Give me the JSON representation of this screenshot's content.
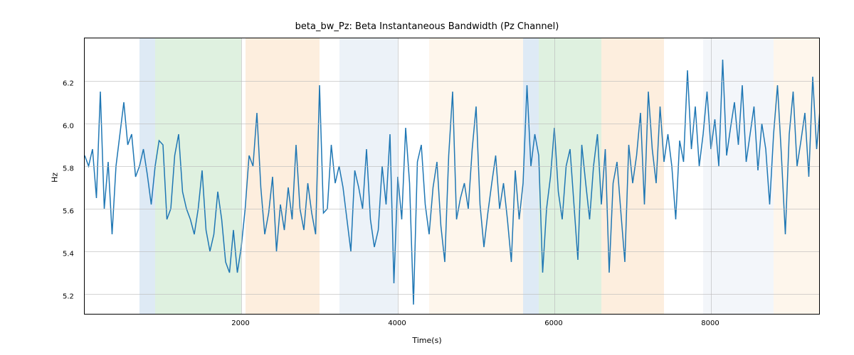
{
  "chart_data": {
    "type": "line",
    "title": "beta_bw_Pz: Beta Instantaneous Bandwidth (Pz Channel)",
    "xlabel": "Time(s)",
    "ylabel": "Hz",
    "xlim": [
      0,
      9400
    ],
    "ylim": [
      5.1,
      6.4
    ],
    "xticks": [
      2000,
      4000,
      6000,
      8000
    ],
    "yticks": [
      5.2,
      5.4,
      5.6,
      5.8,
      6.0,
      6.2
    ],
    "bg_spans": [
      {
        "x0": 700,
        "x1": 900,
        "color": "#6a9ed0"
      },
      {
        "x0": 900,
        "x1": 2000,
        "color": "#6fbf73"
      },
      {
        "x0": 2050,
        "x1": 3000,
        "color": "#f7b267"
      },
      {
        "x0": 3250,
        "x1": 4000,
        "color": "#a9c4e0"
      },
      {
        "x0": 4400,
        "x1": 5600,
        "color": "#f9d6a8"
      },
      {
        "x0": 5600,
        "x1": 5800,
        "color": "#6a9ed0"
      },
      {
        "x0": 5800,
        "x1": 6600,
        "color": "#6fbf73"
      },
      {
        "x0": 6600,
        "x1": 7400,
        "color": "#f7b267"
      },
      {
        "x0": 7900,
        "x1": 8800,
        "color": "#c7d7ea"
      },
      {
        "x0": 8800,
        "x1": 9400,
        "color": "#f9d6a8"
      }
    ],
    "series": [
      {
        "name": "beta_bw_Pz",
        "color": "#1f77b4",
        "x": [
          0,
          50,
          100,
          150,
          200,
          250,
          300,
          350,
          400,
          450,
          500,
          550,
          600,
          650,
          700,
          750,
          800,
          850,
          900,
          950,
          1000,
          1050,
          1100,
          1150,
          1200,
          1250,
          1300,
          1350,
          1400,
          1450,
          1500,
          1550,
          1600,
          1650,
          1700,
          1750,
          1800,
          1850,
          1900,
          1950,
          2000,
          2050,
          2100,
          2150,
          2200,
          2250,
          2300,
          2350,
          2400,
          2450,
          2500,
          2550,
          2600,
          2650,
          2700,
          2750,
          2800,
          2850,
          2900,
          2950,
          3000,
          3050,
          3100,
          3150,
          3200,
          3250,
          3300,
          3350,
          3400,
          3450,
          3500,
          3550,
          3600,
          3650,
          3700,
          3750,
          3800,
          3850,
          3900,
          3950,
          4000,
          4050,
          4100,
          4150,
          4200,
          4250,
          4300,
          4350,
          4400,
          4450,
          4500,
          4550,
          4600,
          4650,
          4700,
          4750,
          4800,
          4850,
          4900,
          4950,
          5000,
          5050,
          5100,
          5150,
          5200,
          5250,
          5300,
          5350,
          5400,
          5450,
          5500,
          5550,
          5600,
          5650,
          5700,
          5750,
          5800,
          5850,
          5900,
          5950,
          6000,
          6050,
          6100,
          6150,
          6200,
          6250,
          6300,
          6350,
          6400,
          6450,
          6500,
          6550,
          6600,
          6650,
          6700,
          6750,
          6800,
          6850,
          6900,
          6950,
          7000,
          7050,
          7100,
          7150,
          7200,
          7250,
          7300,
          7350,
          7400,
          7450,
          7500,
          7550,
          7600,
          7650,
          7700,
          7750,
          7800,
          7850,
          7900,
          7950,
          8000,
          8050,
          8100,
          8150,
          8200,
          8250,
          8300,
          8350,
          8400,
          8450,
          8500,
          8550,
          8600,
          8650,
          8700,
          8750,
          8800,
          8850,
          8900,
          8950,
          9000,
          9050,
          9100,
          9150,
          9200,
          9250,
          9300,
          9350,
          9400
        ],
        "y": [
          5.85,
          5.8,
          5.88,
          5.65,
          6.15,
          5.6,
          5.82,
          5.48,
          5.8,
          5.95,
          6.1,
          5.9,
          5.95,
          5.75,
          5.8,
          5.88,
          5.76,
          5.62,
          5.8,
          5.92,
          5.9,
          5.55,
          5.6,
          5.85,
          5.95,
          5.68,
          5.6,
          5.55,
          5.48,
          5.6,
          5.78,
          5.5,
          5.4,
          5.48,
          5.68,
          5.55,
          5.35,
          5.3,
          5.5,
          5.3,
          5.42,
          5.6,
          5.85,
          5.8,
          6.05,
          5.7,
          5.48,
          5.58,
          5.75,
          5.4,
          5.62,
          5.5,
          5.7,
          5.55,
          5.9,
          5.6,
          5.5,
          5.72,
          5.58,
          5.48,
          6.18,
          5.58,
          5.6,
          5.9,
          5.72,
          5.8,
          5.7,
          5.55,
          5.4,
          5.78,
          5.7,
          5.6,
          5.88,
          5.55,
          5.42,
          5.5,
          5.8,
          5.62,
          5.95,
          5.25,
          5.75,
          5.55,
          5.98,
          5.72,
          5.15,
          5.82,
          5.9,
          5.62,
          5.48,
          5.7,
          5.82,
          5.52,
          5.35,
          5.85,
          6.15,
          5.55,
          5.65,
          5.72,
          5.6,
          5.88,
          6.08,
          5.62,
          5.42,
          5.58,
          5.72,
          5.85,
          5.6,
          5.72,
          5.55,
          5.35,
          5.78,
          5.55,
          5.72,
          6.18,
          5.8,
          5.95,
          5.85,
          5.3,
          5.6,
          5.75,
          5.98,
          5.68,
          5.55,
          5.8,
          5.88,
          5.62,
          5.36,
          5.9,
          5.72,
          5.55,
          5.8,
          5.95,
          5.62,
          5.88,
          5.3,
          5.72,
          5.82,
          5.58,
          5.35,
          5.9,
          5.72,
          5.85,
          6.05,
          5.62,
          6.15,
          5.88,
          5.72,
          6.08,
          5.82,
          5.95,
          5.8,
          5.55,
          5.92,
          5.82,
          6.25,
          5.88,
          6.08,
          5.8,
          5.95,
          6.15,
          5.88,
          6.02,
          5.8,
          6.3,
          5.85,
          5.98,
          6.1,
          5.9,
          6.18,
          5.82,
          5.95,
          6.08,
          5.78,
          6.0,
          5.88,
          5.62,
          5.95,
          6.18,
          5.85,
          5.48,
          5.95,
          6.15,
          5.8,
          5.92,
          6.05,
          5.75,
          6.22,
          5.88,
          6.1
        ]
      }
    ]
  }
}
